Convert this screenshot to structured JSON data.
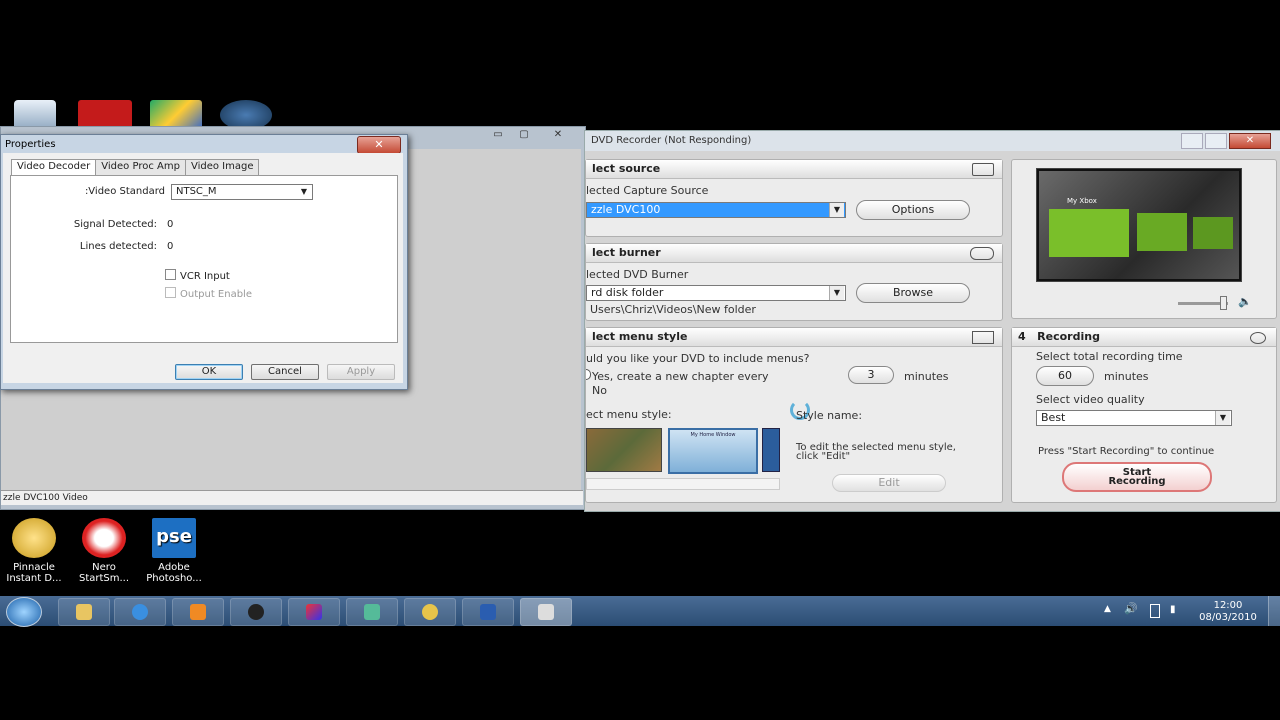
{
  "desktop": {
    "top_icons": [
      "recycle-bin",
      "red-app",
      "windows-media",
      "tv-app"
    ],
    "bottom_icons": [
      {
        "label": "Pinnacle Instant D...",
        "icon": "pinnacle-icon",
        "line1": "Pinnacle",
        "line2": "Instant D..."
      },
      {
        "label": "Nero StartSm...",
        "icon": "nero-icon",
        "line1": "Nero",
        "line2": "StartSm..."
      },
      {
        "label": "Adobe Photosho...",
        "icon": "photoshop-icon",
        "line1": "Adobe",
        "line2": "Photosho...",
        "glyph": "pse"
      }
    ]
  },
  "video_window": {
    "status": "zzle DVC100 Video",
    "controls": [
      "▭",
      "▢",
      "✕"
    ]
  },
  "properties": {
    "title": "Properties",
    "close": "✕",
    "tabs": [
      "Video Decoder",
      "Video Proc Amp",
      "Video Image"
    ],
    "video_standard_label": ":Video Standard",
    "video_standard_value": "NTSC_M",
    "signal_label": "Signal Detected:",
    "signal_value": "0",
    "lines_label": "Lines detected:",
    "lines_value": "0",
    "vcr_input": "VCR Input",
    "output_enable": "Output Enable",
    "ok": "OK",
    "cancel": "Cancel",
    "apply": "Apply"
  },
  "dvd": {
    "title": "DVD Recorder (Not Responding)",
    "source": {
      "header": "lect source",
      "label": "lected Capture Source",
      "value": "zzle DVC100",
      "options": "Options"
    },
    "burner": {
      "header": "lect burner",
      "label": "lected DVD Burner",
      "value": "rd disk folder",
      "path": "Users\\Chriz\\Videos\\New folder",
      "browse": "Browse"
    },
    "menu": {
      "header": "lect menu style",
      "question": "uld you like your DVD to include menus?",
      "yes": "Yes, create a new chapter every",
      "chapter_value": "3",
      "minutes": "minutes",
      "no": "No",
      "style_label": "ect menu style:",
      "style_name": "Style name:",
      "edit_hint1": "To edit the selected menu style,",
      "edit_hint2": "click \"Edit\"",
      "edit": "Edit",
      "thumb2_caption": "My Home Window"
    },
    "preview": {
      "caption": "My Xbox"
    },
    "recording": {
      "number": "4",
      "header": "Recording",
      "time_label": "Select total recording time",
      "time_value": "60",
      "minutes": "minutes",
      "quality_label": "Select video quality",
      "quality_value": "Best",
      "press_hint": "Press \"Start Recording\" to continue",
      "start_line1": "Start",
      "start_line2": "Recording"
    }
  },
  "taskbar": {
    "time": "12:00",
    "date": "08/03/2010",
    "items": [
      "explorer",
      "ie",
      "media-player",
      "tv",
      "paint",
      "people",
      "pinnacle",
      "film",
      "dvd-recorder"
    ]
  }
}
